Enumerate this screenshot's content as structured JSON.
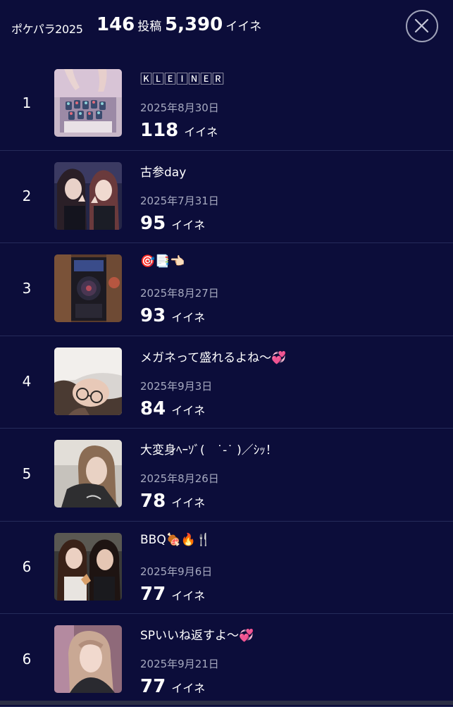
{
  "header": {
    "title": "ポケパラ2025",
    "post_count": "146",
    "post_unit": "投稿",
    "like_count": "5,390",
    "like_unit": "イイネ"
  },
  "posts": [
    {
      "rank": "1",
      "title": "🄺🄻🄴🄸🄽🄴🅁",
      "date": "2025年8月30日",
      "likes": "118",
      "likes_unit": "イイネ"
    },
    {
      "rank": "2",
      "title": "古参day",
      "date": "2025年7月31日",
      "likes": "95",
      "likes_unit": "イイネ"
    },
    {
      "rank": "3",
      "title": "🎯📑👈🏻",
      "date": "2025年8月27日",
      "likes": "93",
      "likes_unit": "イイネ"
    },
    {
      "rank": "4",
      "title": "メガネって盛れるよね〜💞",
      "date": "2025年9月3日",
      "likes": "84",
      "likes_unit": "イイネ"
    },
    {
      "rank": "5",
      "title": "大変身ﾍｰｿﾞ(　˙-˙ )／ｼｯ！",
      "date": "2025年8月26日",
      "likes": "78",
      "likes_unit": "イイネ"
    },
    {
      "rank": "6",
      "title": "BBQ🍖🔥🍴",
      "date": "2025年9月6日",
      "likes": "77",
      "likes_unit": "イイネ"
    },
    {
      "rank": "6",
      "title": "SPいいね返すよ〜💞",
      "date": "2025年9月21日",
      "likes": "77",
      "likes_unit": "イイネ"
    }
  ]
}
